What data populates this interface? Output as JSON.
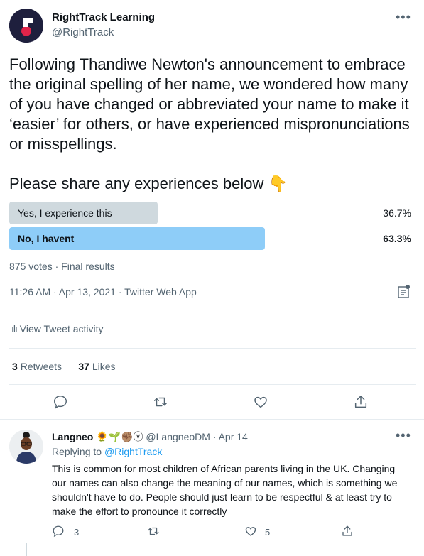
{
  "tweet": {
    "author_name": "RightTrack Learning",
    "author_handle": "@RightTrack",
    "more_icon": "more-icon",
    "text": "Following Thandiwe Newton's announcement to embrace the original spelling of her name, we wondered how many of you have changed or abbreviated your name to make it ‘easier’ for others, or have experienced mispronunciations or misspellings.",
    "text2": "Please share any experiences below",
    "emoji": "👇"
  },
  "poll": {
    "options": [
      {
        "label": "Yes, I experience this",
        "percent_text": "36.7%",
        "percent": 36.7,
        "color": "#cfd9de",
        "winner": false
      },
      {
        "label": "No, I havent",
        "percent_text": "63.3%",
        "percent": 63.3,
        "color": "#8ecdf8",
        "winner": true
      }
    ],
    "summary": "875 votes · Final results"
  },
  "meta": {
    "timestamp": "11:26 AM · Apr 13, 2021 · Twitter Web App",
    "activity": "View Tweet activity"
  },
  "stats": {
    "retweets_count": "3",
    "retweets_label": "Retweets",
    "likes_count": "37",
    "likes_label": "Likes"
  },
  "reply": {
    "name": "Langneo",
    "emojis": "🌻🌱✊🏽ⓥ",
    "handle_time": "@LangneoDM · Apr 14",
    "replying_prefix": "Replying to",
    "replying_to": "@RightTrack",
    "text": "This is common for most children of African parents living in the UK. Changing our names can also change the meaning of our names, which is something we shouldn't have to do. People should just learn to be respectful & at least try to make the effort to pronounce it correctly",
    "reply_count": "3",
    "like_count": "5"
  },
  "colors": {
    "accent": "#1d9bf0",
    "muted": "#536471",
    "divider": "#e6ecf0"
  }
}
